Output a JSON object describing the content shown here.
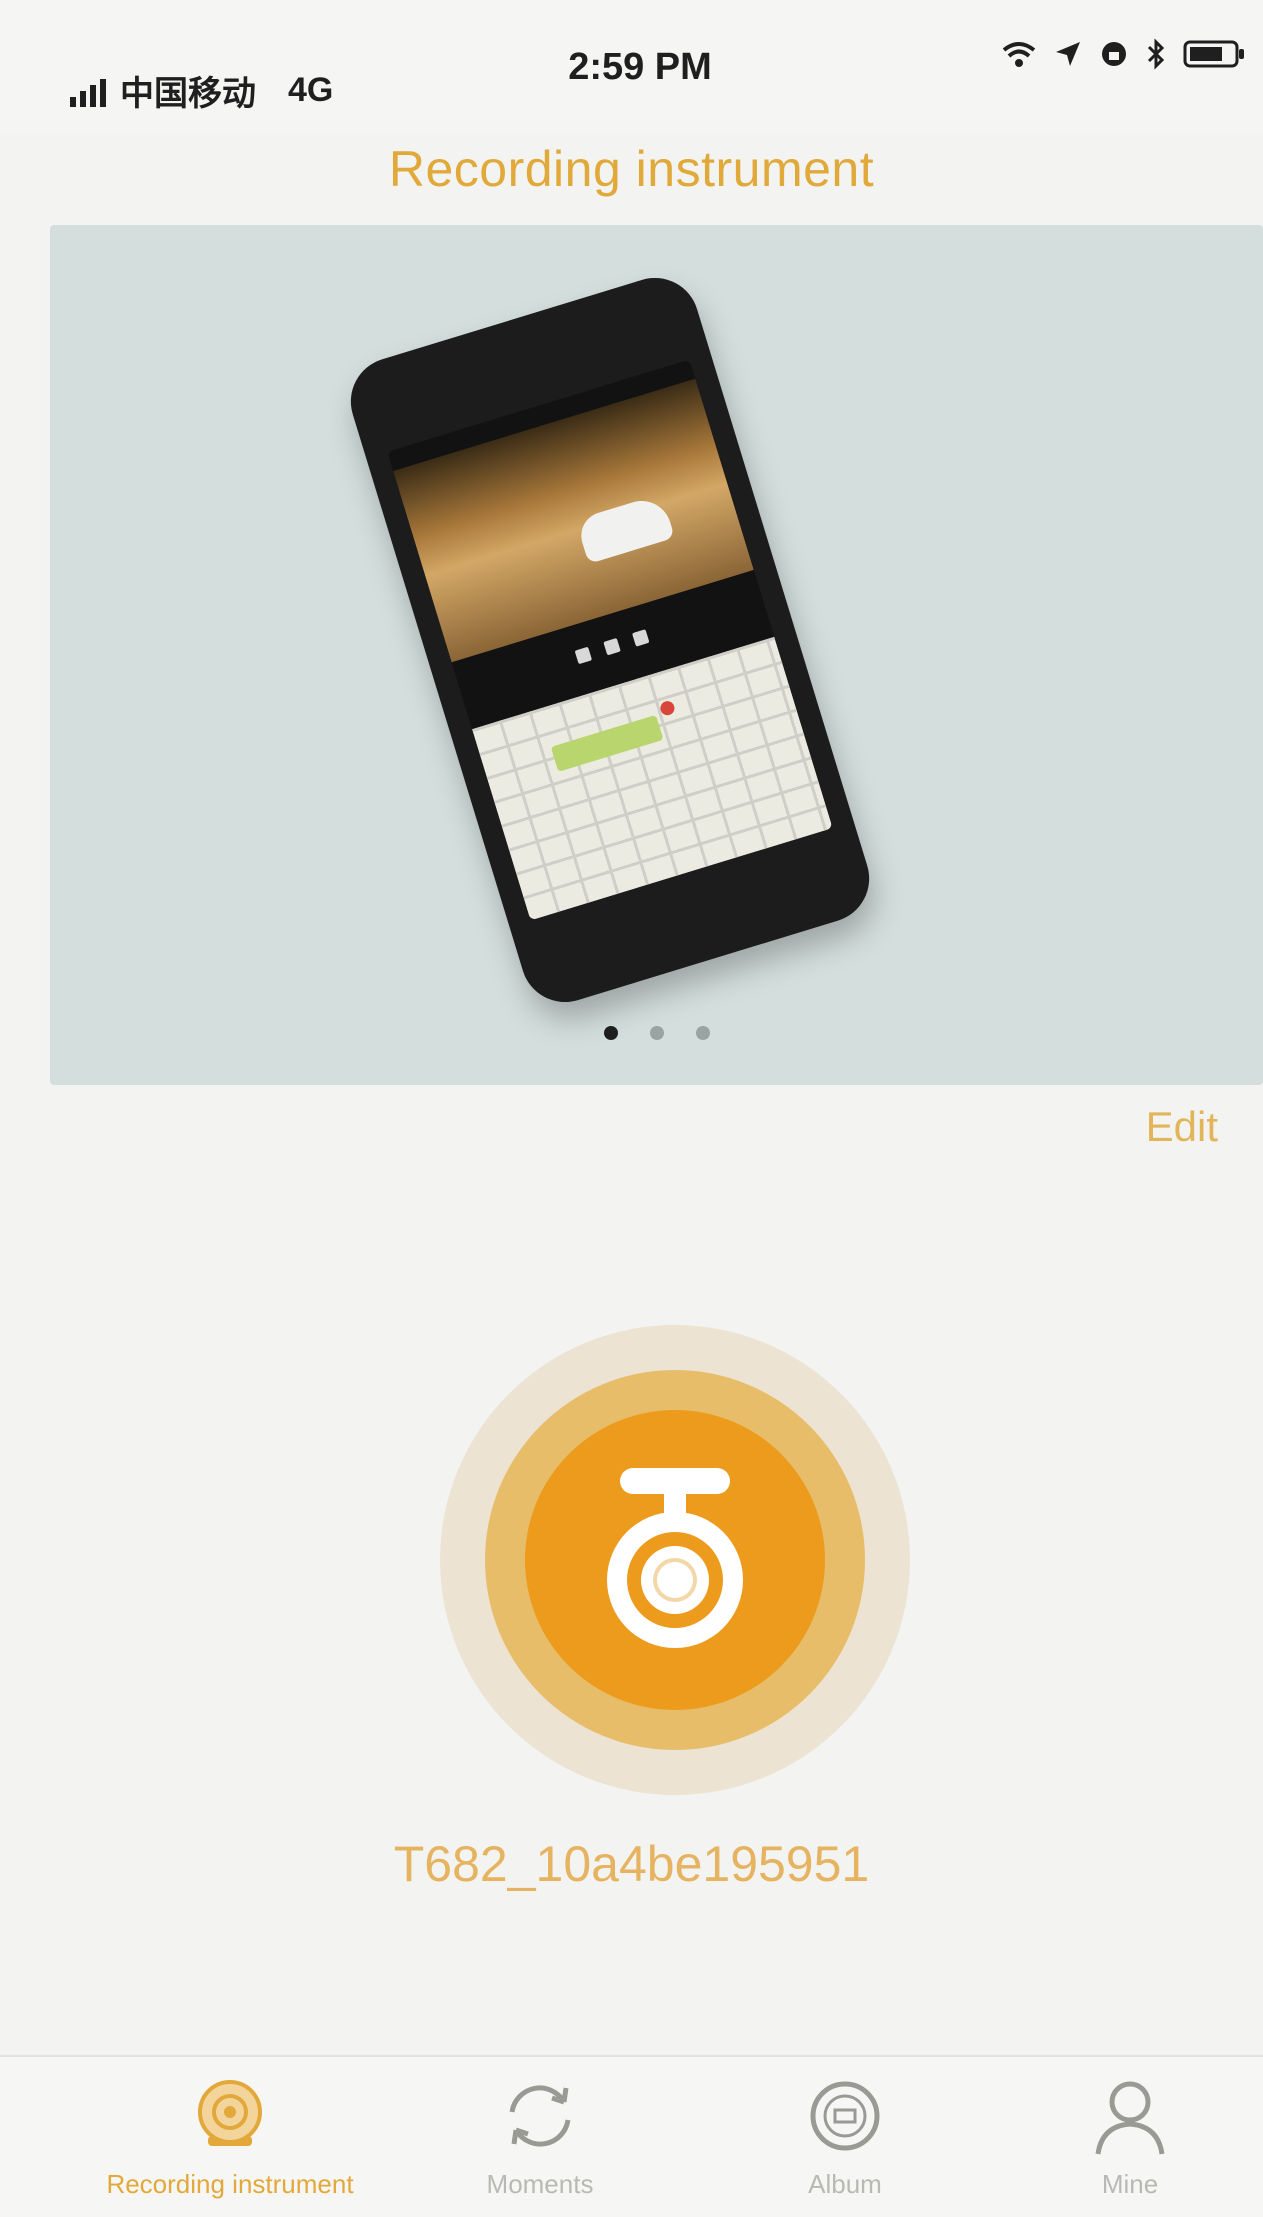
{
  "status_bar": {
    "carrier": "中国移动",
    "network": "4G",
    "time": "2:59 PM"
  },
  "header": {
    "title": "Recording instrument"
  },
  "banner": {
    "dots": 3,
    "active_dot": 0
  },
  "edit_label": "Edit",
  "device": {
    "name": "T682_10a4be195951",
    "icon": "dashcam-icon"
  },
  "tabs": [
    {
      "label": "Recording instrument",
      "icon": "dashcam-icon",
      "active": true
    },
    {
      "label": "Moments",
      "icon": "refresh-cycle-icon",
      "active": false
    },
    {
      "label": "Album",
      "icon": "album-icon",
      "active": false
    },
    {
      "label": "Mine",
      "icon": "person-icon",
      "active": false
    }
  ],
  "colors": {
    "accent": "#e3a83a",
    "device_orange": "#ec9b1d",
    "inactive_tab": "#b9b9b4",
    "banner_bg": "#d4dfdd"
  }
}
